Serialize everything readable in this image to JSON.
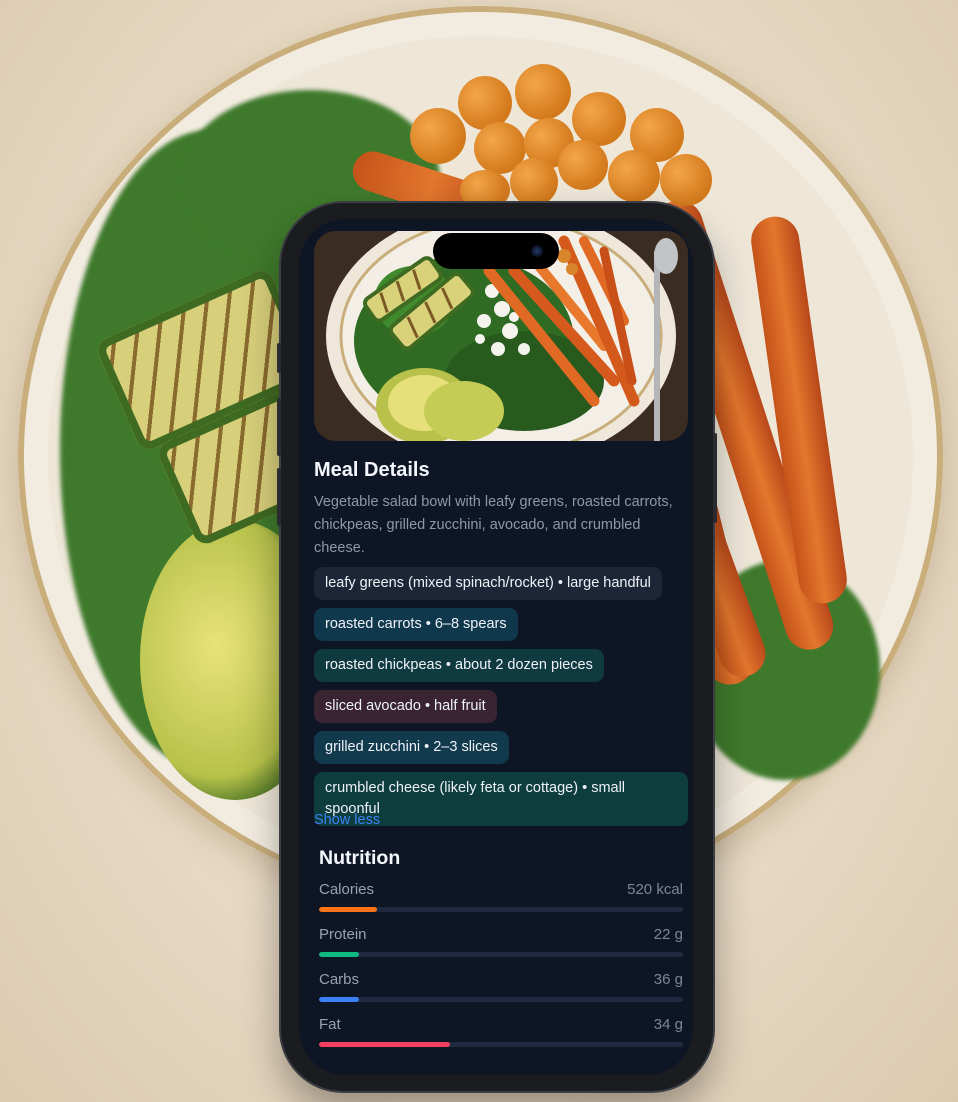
{
  "meal": {
    "title": "Meal Details",
    "description": "Vegetable salad bowl with leafy greens, roasted carrots, chickpeas, grilled zucchini, avocado, and crumbled cheese.",
    "ingredients": [
      {
        "label": "leafy greens (mixed spinach/rocket) • large handful",
        "color": "#1d2637"
      },
      {
        "label": "roasted carrots • 6–8 spears",
        "color": "#10384c"
      },
      {
        "label": "roasted chickpeas • about 2 dozen pieces",
        "color": "#0f3a3f"
      },
      {
        "label": "sliced avocado • half fruit",
        "color": "#3a2431"
      },
      {
        "label": "grilled zucchini • 2–3 slices",
        "color": "#123a4d"
      },
      {
        "label": "crumbled cheese (likely feta or cottage) • small spoonful",
        "color": "#0e3d3d"
      }
    ],
    "toggle_label": "Show less"
  },
  "nutrition": {
    "title": "Nutrition",
    "items": [
      {
        "label": "Calories",
        "value": "520 kcal",
        "fraction": 0.16,
        "color": "#f97316"
      },
      {
        "label": "Protein",
        "value": "22 g",
        "fraction": 0.11,
        "color": "#10b981"
      },
      {
        "label": "Carbs",
        "value": "36 g",
        "fraction": 0.11,
        "color": "#3b82f6"
      },
      {
        "label": "Fat",
        "value": "34 g",
        "fraction": 0.36,
        "color": "#f43f5e"
      }
    ]
  }
}
